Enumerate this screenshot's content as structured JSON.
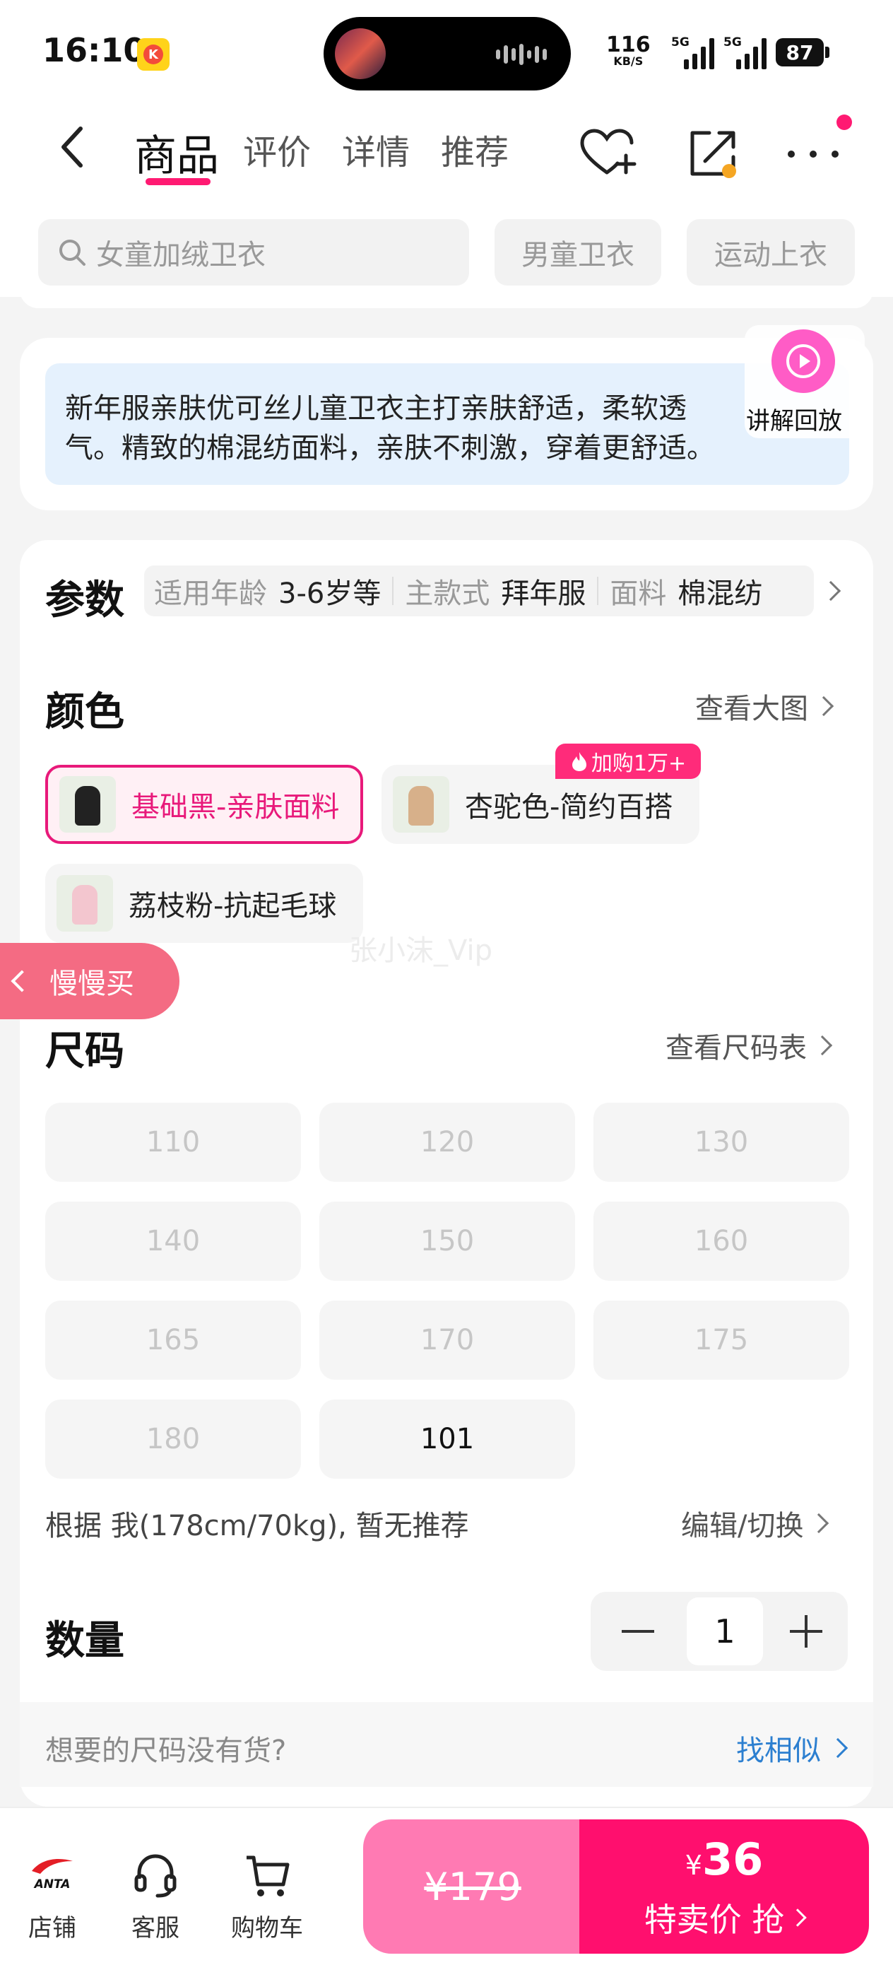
{
  "status_bar": {
    "time": "16:10",
    "net_speed": "116",
    "net_unit": "KB/S",
    "sim1": "5G",
    "sim2": "5G",
    "battery": "87"
  },
  "nav": {
    "tabs": [
      {
        "label": "商品",
        "active": true
      },
      {
        "label": "评价",
        "active": false
      },
      {
        "label": "详情",
        "active": false
      },
      {
        "label": "推荐",
        "active": false
      }
    ],
    "accent": "#ff1a72"
  },
  "search": {
    "placeholder": "女童加绒卫衣",
    "chips": [
      "男童卫衣",
      "运动上衣"
    ]
  },
  "intro": {
    "text_line1": "新年服亲肤优可丝儿童卫衣主打亲肤舒适，柔软透",
    "text_line2": "气。精致的棉混纺面料，亲肤不刺激，穿着更舒适。",
    "replay_label": "讲解回放"
  },
  "params": {
    "title": "参数",
    "items": [
      {
        "key": "适用年龄",
        "value": "3-6岁等"
      },
      {
        "key": "主款式",
        "value": "拜年服"
      },
      {
        "key": "面料",
        "value": "棉混纺"
      }
    ]
  },
  "colors": {
    "title": "颜色",
    "view_large": "查看大图",
    "badge": "加购1万+",
    "options": [
      {
        "label": "基础黑-亲肤面料",
        "selected": true,
        "swatch": "#222222"
      },
      {
        "label": "杏驼色-简约百搭",
        "selected": false,
        "swatch": "#d7b08a"
      },
      {
        "label": "荔枝粉-抗起毛球",
        "selected": false,
        "swatch": "#f3c6cf"
      }
    ]
  },
  "floating": {
    "slow_buy": "慢慢买",
    "watermark": "张小沫_Vip"
  },
  "sizes": {
    "title": "尺码",
    "chart_link": "查看尺码表",
    "options": [
      {
        "label": "110",
        "available": false
      },
      {
        "label": "120",
        "available": false
      },
      {
        "label": "130",
        "available": false
      },
      {
        "label": "140",
        "available": false
      },
      {
        "label": "150",
        "available": false
      },
      {
        "label": "160",
        "available": false
      },
      {
        "label": "165",
        "available": false
      },
      {
        "label": "170",
        "available": false
      },
      {
        "label": "175",
        "available": false
      },
      {
        "label": "180",
        "available": false
      },
      {
        "label": "101",
        "available": true
      }
    ],
    "recommend_text": "根据 我(178cm/70kg), 暂无推荐",
    "edit_link": "编辑/切换"
  },
  "quantity": {
    "title": "数量",
    "value": "1"
  },
  "no_stock": {
    "question": "想要的尺码没有货?",
    "find_similar": "找相似"
  },
  "bottom_bar": {
    "store": "店铺",
    "service": "客服",
    "cart": "购物车",
    "brand": "ANTA",
    "original_price": "¥179",
    "currency": "¥",
    "sale_price": "36",
    "buy_label": "特卖价 抢"
  }
}
